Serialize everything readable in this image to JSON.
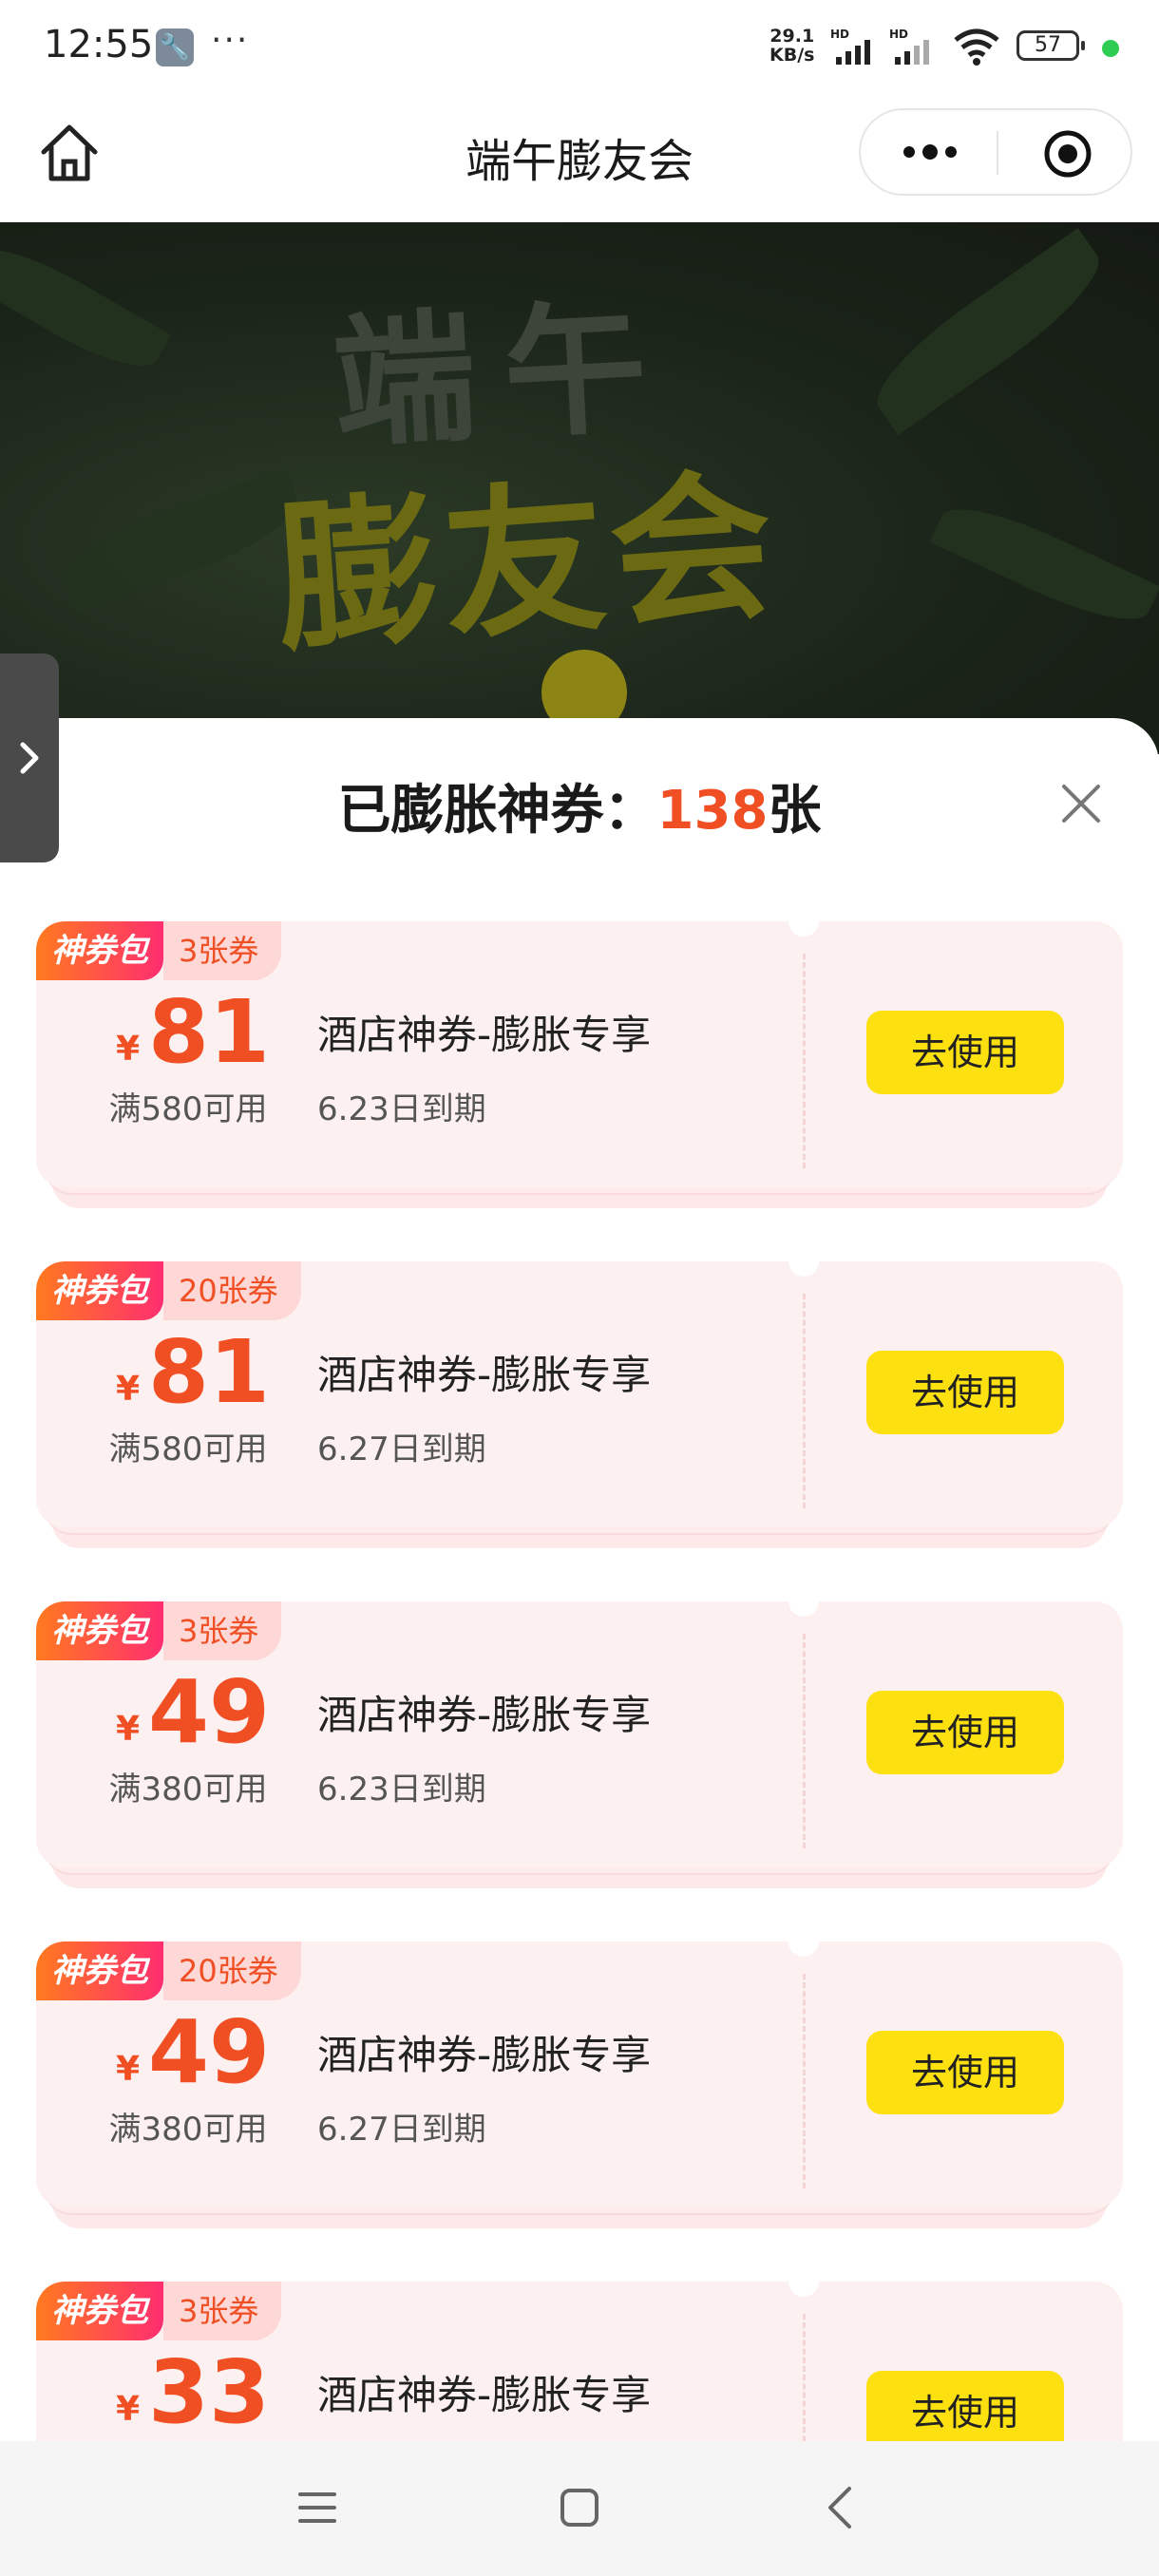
{
  "status_bar": {
    "time": "12:55",
    "net_speed_value": "29.1",
    "net_speed_unit": "KB/s",
    "sim1_label": "HD",
    "sim2_label": "HD",
    "battery": "57"
  },
  "header": {
    "title": "端午膨友会"
  },
  "banner": {
    "line1": "端午",
    "line2": "膨友会"
  },
  "sheet": {
    "title_prefix": "已膨胀神券：",
    "count": "138",
    "title_suffix": "张"
  },
  "coupons": [
    {
      "badge": "神券包",
      "count_label": "3张券",
      "currency": "¥",
      "amount": "81",
      "condition": "满580可用",
      "name": "酒店神券-膨胀专享",
      "expire": "6.23日到期",
      "button": "去使用"
    },
    {
      "badge": "神券包",
      "count_label": "20张券",
      "currency": "¥",
      "amount": "81",
      "condition": "满580可用",
      "name": "酒店神券-膨胀专享",
      "expire": "6.27日到期",
      "button": "去使用"
    },
    {
      "badge": "神券包",
      "count_label": "3张券",
      "currency": "¥",
      "amount": "49",
      "condition": "满380可用",
      "name": "酒店神券-膨胀专享",
      "expire": "6.23日到期",
      "button": "去使用"
    },
    {
      "badge": "神券包",
      "count_label": "20张券",
      "currency": "¥",
      "amount": "49",
      "condition": "满380可用",
      "name": "酒店神券-膨胀专享",
      "expire": "6.27日到期",
      "button": "去使用"
    },
    {
      "badge": "神券包",
      "count_label": "3张券",
      "currency": "¥",
      "amount": "33",
      "condition": "",
      "name": "酒店神券-膨胀专享",
      "expire": "",
      "button": "去使用"
    }
  ],
  "colors": {
    "accent_red": "#f04e23",
    "button_yellow": "#fde00f",
    "coupon_bg": "#fdf0f0"
  }
}
